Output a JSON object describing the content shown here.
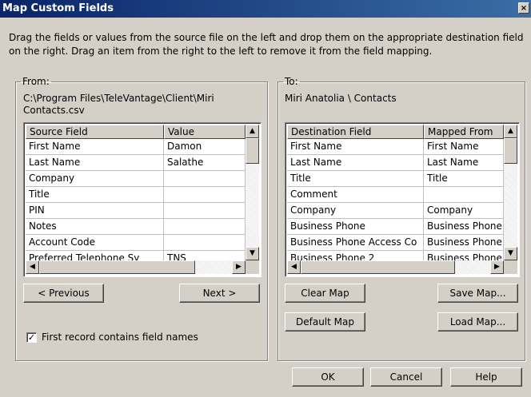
{
  "window": {
    "title": "Map Custom Fields",
    "close_glyph": "×"
  },
  "instructions": "Drag the fields or values from the source file on the left and drop them on the appropriate destination field on the right. Drag an item from the right to the left to remove it from the field mapping.",
  "from": {
    "legend": "From:",
    "path": "C:\\Program Files\\TeleVantage\\Client\\Miri Contacts.csv",
    "columns": [
      "Source Field",
      "Value"
    ],
    "rows": [
      [
        "First Name",
        "Damon"
      ],
      [
        "Last Name",
        "Salathe"
      ],
      [
        "Company",
        ""
      ],
      [
        "Title",
        ""
      ],
      [
        "PIN",
        ""
      ],
      [
        "Notes",
        ""
      ],
      [
        "Account Code",
        ""
      ],
      [
        "Preferred Telephone Sy",
        "TNS"
      ]
    ],
    "previous_label": "< Previous",
    "next_label": "Next >",
    "checkbox_label": "First record contains field names",
    "checkbox_checked": true
  },
  "to": {
    "legend": "To:",
    "target": "Miri Anatolia \\ Contacts",
    "columns": [
      "Destination Field",
      "Mapped From"
    ],
    "rows": [
      [
        "First Name",
        "First Name"
      ],
      [
        "Last Name",
        "Last Name"
      ],
      [
        "Title",
        "Title"
      ],
      [
        "Comment",
        ""
      ],
      [
        "Company",
        "Company"
      ],
      [
        "Business Phone",
        "Business Phone"
      ],
      [
        "Business Phone Access Co",
        "Business Phone"
      ],
      [
        "Business Phone 2",
        "Business Phone"
      ]
    ],
    "clear_map_label": "Clear Map",
    "default_map_label": "Default Map",
    "save_map_label": "Save Map...",
    "load_map_label": "Load Map..."
  },
  "footer": {
    "ok_label": "OK",
    "cancel_label": "Cancel",
    "help_label": "Help"
  },
  "icons": {
    "scroll_up": "▲",
    "scroll_down": "▼",
    "scroll_left": "◀",
    "scroll_right": "▶",
    "check": "✓"
  }
}
